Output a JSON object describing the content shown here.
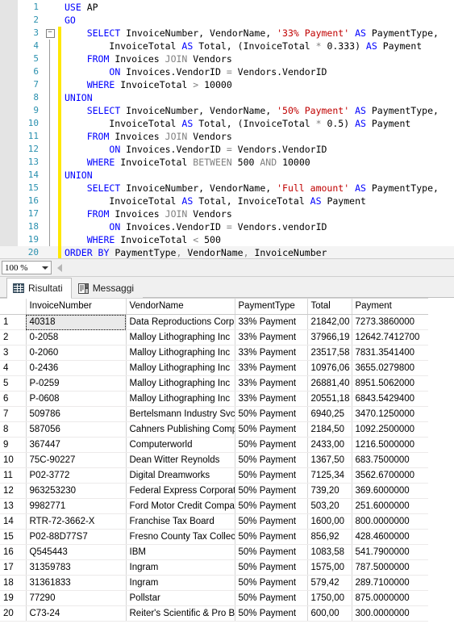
{
  "editor": {
    "zoom_level": "100 %",
    "current_line": 20,
    "lines": [
      {
        "n": 1,
        "segments": [
          {
            "t": "USE ",
            "c": "kw"
          },
          {
            "t": "AP",
            "c": ""
          }
        ]
      },
      {
        "n": 2,
        "segments": [
          {
            "t": "GO",
            "c": "kw"
          }
        ]
      },
      {
        "n": 3,
        "fold": true,
        "segments": [
          {
            "t": "    ",
            "c": ""
          },
          {
            "t": "SELECT ",
            "c": "kw"
          },
          {
            "t": "InvoiceNumber, VendorName, ",
            "c": ""
          },
          {
            "t": "'33% Payment'",
            "c": "str"
          },
          {
            "t": " ",
            "c": ""
          },
          {
            "t": "AS",
            "c": "kw"
          },
          {
            "t": " PaymentType,",
            "c": ""
          }
        ]
      },
      {
        "n": 4,
        "segments": [
          {
            "t": "        InvoiceTotal ",
            "c": ""
          },
          {
            "t": "AS",
            "c": "kw"
          },
          {
            "t": " Total, (InvoiceTotal ",
            "c": ""
          },
          {
            "t": "*",
            "c": "kw2"
          },
          {
            "t": " 0.333) ",
            "c": ""
          },
          {
            "t": "AS",
            "c": "kw"
          },
          {
            "t": " Payment",
            "c": ""
          }
        ]
      },
      {
        "n": 5,
        "segments": [
          {
            "t": "    ",
            "c": ""
          },
          {
            "t": "FROM",
            "c": "kw"
          },
          {
            "t": " Invoices ",
            "c": ""
          },
          {
            "t": "JOIN",
            "c": "kw2"
          },
          {
            "t": " Vendors",
            "c": ""
          }
        ]
      },
      {
        "n": 6,
        "segments": [
          {
            "t": "        ",
            "c": ""
          },
          {
            "t": "ON",
            "c": "kw"
          },
          {
            "t": " Invoices.VendorID ",
            "c": ""
          },
          {
            "t": "=",
            "c": "kw2"
          },
          {
            "t": " Vendors.VendorID",
            "c": ""
          }
        ]
      },
      {
        "n": 7,
        "segments": [
          {
            "t": "    ",
            "c": ""
          },
          {
            "t": "WHERE",
            "c": "kw"
          },
          {
            "t": " InvoiceTotal ",
            "c": ""
          },
          {
            "t": ">",
            "c": "kw2"
          },
          {
            "t": " 10000",
            "c": ""
          }
        ]
      },
      {
        "n": 8,
        "segments": [
          {
            "t": "UNION",
            "c": "kw"
          }
        ]
      },
      {
        "n": 9,
        "segments": [
          {
            "t": "    ",
            "c": ""
          },
          {
            "t": "SELECT ",
            "c": "kw"
          },
          {
            "t": "InvoiceNumber, VendorName, ",
            "c": ""
          },
          {
            "t": "'50% Payment'",
            "c": "str"
          },
          {
            "t": " ",
            "c": ""
          },
          {
            "t": "AS",
            "c": "kw"
          },
          {
            "t": " PaymentType,",
            "c": ""
          }
        ]
      },
      {
        "n": 10,
        "segments": [
          {
            "t": "        InvoiceTotal ",
            "c": ""
          },
          {
            "t": "AS",
            "c": "kw"
          },
          {
            "t": " Total, (InvoiceTotal ",
            "c": ""
          },
          {
            "t": "*",
            "c": "kw2"
          },
          {
            "t": " 0.5) ",
            "c": ""
          },
          {
            "t": "AS",
            "c": "kw"
          },
          {
            "t": " Payment",
            "c": ""
          }
        ]
      },
      {
        "n": 11,
        "segments": [
          {
            "t": "    ",
            "c": ""
          },
          {
            "t": "FROM",
            "c": "kw"
          },
          {
            "t": " Invoices ",
            "c": ""
          },
          {
            "t": "JOIN",
            "c": "kw2"
          },
          {
            "t": " Vendors",
            "c": ""
          }
        ]
      },
      {
        "n": 12,
        "segments": [
          {
            "t": "        ",
            "c": ""
          },
          {
            "t": "ON",
            "c": "kw"
          },
          {
            "t": " Invoices.VendorID ",
            "c": ""
          },
          {
            "t": "=",
            "c": "kw2"
          },
          {
            "t": " Vendors.VendorID",
            "c": ""
          }
        ]
      },
      {
        "n": 13,
        "segments": [
          {
            "t": "    ",
            "c": ""
          },
          {
            "t": "WHERE",
            "c": "kw"
          },
          {
            "t": " InvoiceTotal ",
            "c": ""
          },
          {
            "t": "BETWEEN",
            "c": "kw2"
          },
          {
            "t": " 500 ",
            "c": ""
          },
          {
            "t": "AND",
            "c": "kw2"
          },
          {
            "t": " 10000",
            "c": ""
          }
        ]
      },
      {
        "n": 14,
        "segments": [
          {
            "t": "UNION",
            "c": "kw"
          }
        ]
      },
      {
        "n": 15,
        "segments": [
          {
            "t": "    ",
            "c": ""
          },
          {
            "t": "SELECT ",
            "c": "kw"
          },
          {
            "t": "InvoiceNumber, VendorName, ",
            "c": ""
          },
          {
            "t": "'Full amount'",
            "c": "str"
          },
          {
            "t": " ",
            "c": ""
          },
          {
            "t": "AS",
            "c": "kw"
          },
          {
            "t": " PaymentType,",
            "c": ""
          }
        ]
      },
      {
        "n": 16,
        "segments": [
          {
            "t": "        InvoiceTotal ",
            "c": ""
          },
          {
            "t": "AS",
            "c": "kw"
          },
          {
            "t": " Total, InvoiceTotal ",
            "c": ""
          },
          {
            "t": "AS",
            "c": "kw"
          },
          {
            "t": " Payment",
            "c": ""
          }
        ]
      },
      {
        "n": 17,
        "segments": [
          {
            "t": "    ",
            "c": ""
          },
          {
            "t": "FROM",
            "c": "kw"
          },
          {
            "t": " Invoices ",
            "c": ""
          },
          {
            "t": "JOIN",
            "c": "kw2"
          },
          {
            "t": " Vendors",
            "c": ""
          }
        ]
      },
      {
        "n": 18,
        "segments": [
          {
            "t": "        ",
            "c": ""
          },
          {
            "t": "ON",
            "c": "kw"
          },
          {
            "t": " Invoices.VendorID ",
            "c": ""
          },
          {
            "t": "=",
            "c": "kw2"
          },
          {
            "t": " Vendors.vendorID",
            "c": ""
          }
        ]
      },
      {
        "n": 19,
        "segments": [
          {
            "t": "    ",
            "c": ""
          },
          {
            "t": "WHERE",
            "c": "kw"
          },
          {
            "t": " InvoiceTotal ",
            "c": ""
          },
          {
            "t": "<",
            "c": "kw2"
          },
          {
            "t": " 500",
            "c": ""
          }
        ]
      },
      {
        "n": 20,
        "segments": [
          {
            "t": "ORDER BY",
            "c": "kw"
          },
          {
            "t": " PaymentType",
            "c": ""
          },
          {
            "t": ",",
            "c": "kw2"
          },
          {
            "t": " VendorName",
            "c": ""
          },
          {
            "t": ",",
            "c": "kw2"
          },
          {
            "t": " InvoiceNumber",
            "c": ""
          }
        ]
      }
    ]
  },
  "tabs": [
    {
      "label": "Risultati",
      "icon": "grid-icon",
      "active": true
    },
    {
      "label": "Messaggi",
      "icon": "message-icon",
      "active": false
    }
  ],
  "results": {
    "columns": [
      "InvoiceNumber",
      "VendorName",
      "PaymentType",
      "Total",
      "Payment"
    ],
    "selected_cell": {
      "row": 1,
      "column": "InvoiceNumber"
    },
    "rows": [
      {
        "n": "1",
        "InvoiceNumber": "40318",
        "VendorName": "Data Reproductions Corp",
        "PaymentType": "33% Payment",
        "Total": "21842,00",
        "Payment": "7273.3860000"
      },
      {
        "n": "2",
        "InvoiceNumber": "0-2058",
        "VendorName": "Malloy Lithographing Inc",
        "PaymentType": "33% Payment",
        "Total": "37966,19",
        "Payment": "12642.7412700"
      },
      {
        "n": "3",
        "InvoiceNumber": "0-2060",
        "VendorName": "Malloy Lithographing Inc",
        "PaymentType": "33% Payment",
        "Total": "23517,58",
        "Payment": "7831.3541400"
      },
      {
        "n": "4",
        "InvoiceNumber": "0-2436",
        "VendorName": "Malloy Lithographing Inc",
        "PaymentType": "33% Payment",
        "Total": "10976,06",
        "Payment": "3655.0279800"
      },
      {
        "n": "5",
        "InvoiceNumber": "P-0259",
        "VendorName": "Malloy Lithographing Inc",
        "PaymentType": "33% Payment",
        "Total": "26881,40",
        "Payment": "8951.5062000"
      },
      {
        "n": "6",
        "InvoiceNumber": "P-0608",
        "VendorName": "Malloy Lithographing Inc",
        "PaymentType": "33% Payment",
        "Total": "20551,18",
        "Payment": "6843.5429400"
      },
      {
        "n": "7",
        "InvoiceNumber": "509786",
        "VendorName": "Bertelsmann Industry Svcs. Inc",
        "PaymentType": "50% Payment",
        "Total": "6940,25",
        "Payment": "3470.1250000"
      },
      {
        "n": "8",
        "InvoiceNumber": "587056",
        "VendorName": "Cahners Publishing Company",
        "PaymentType": "50% Payment",
        "Total": "2184,50",
        "Payment": "1092.2500000"
      },
      {
        "n": "9",
        "InvoiceNumber": "367447",
        "VendorName": "Computerworld",
        "PaymentType": "50% Payment",
        "Total": "2433,00",
        "Payment": "1216.5000000"
      },
      {
        "n": "10",
        "InvoiceNumber": "75C-90227",
        "VendorName": "Dean Witter Reynolds",
        "PaymentType": "50% Payment",
        "Total": "1367,50",
        "Payment": "683.7500000"
      },
      {
        "n": "11",
        "InvoiceNumber": "P02-3772",
        "VendorName": "Digital Dreamworks",
        "PaymentType": "50% Payment",
        "Total": "7125,34",
        "Payment": "3562.6700000"
      },
      {
        "n": "12",
        "InvoiceNumber": "963253230",
        "VendorName": "Federal Express Corporation",
        "PaymentType": "50% Payment",
        "Total": "739,20",
        "Payment": "369.6000000"
      },
      {
        "n": "13",
        "InvoiceNumber": "9982771",
        "VendorName": "Ford Motor Credit Company",
        "PaymentType": "50% Payment",
        "Total": "503,20",
        "Payment": "251.6000000"
      },
      {
        "n": "14",
        "InvoiceNumber": "RTR-72-3662-X",
        "VendorName": "Franchise Tax Board",
        "PaymentType": "50% Payment",
        "Total": "1600,00",
        "Payment": "800.0000000"
      },
      {
        "n": "15",
        "InvoiceNumber": "P02-88D77S7",
        "VendorName": "Fresno County Tax Collector",
        "PaymentType": "50% Payment",
        "Total": "856,92",
        "Payment": "428.4600000"
      },
      {
        "n": "16",
        "InvoiceNumber": "Q545443",
        "VendorName": "IBM",
        "PaymentType": "50% Payment",
        "Total": "1083,58",
        "Payment": "541.7900000"
      },
      {
        "n": "17",
        "InvoiceNumber": "31359783",
        "VendorName": "Ingram",
        "PaymentType": "50% Payment",
        "Total": "1575,00",
        "Payment": "787.5000000"
      },
      {
        "n": "18",
        "InvoiceNumber": "31361833",
        "VendorName": "Ingram",
        "PaymentType": "50% Payment",
        "Total": "579,42",
        "Payment": "289.7100000"
      },
      {
        "n": "19",
        "InvoiceNumber": "77290",
        "VendorName": "Pollstar",
        "PaymentType": "50% Payment",
        "Total": "1750,00",
        "Payment": "875.0000000"
      },
      {
        "n": "20",
        "InvoiceNumber": "C73-24",
        "VendorName": "Reiter's Scientific & Pro Books",
        "PaymentType": "50% Payment",
        "Total": "600,00",
        "Payment": "300.0000000"
      }
    ]
  }
}
